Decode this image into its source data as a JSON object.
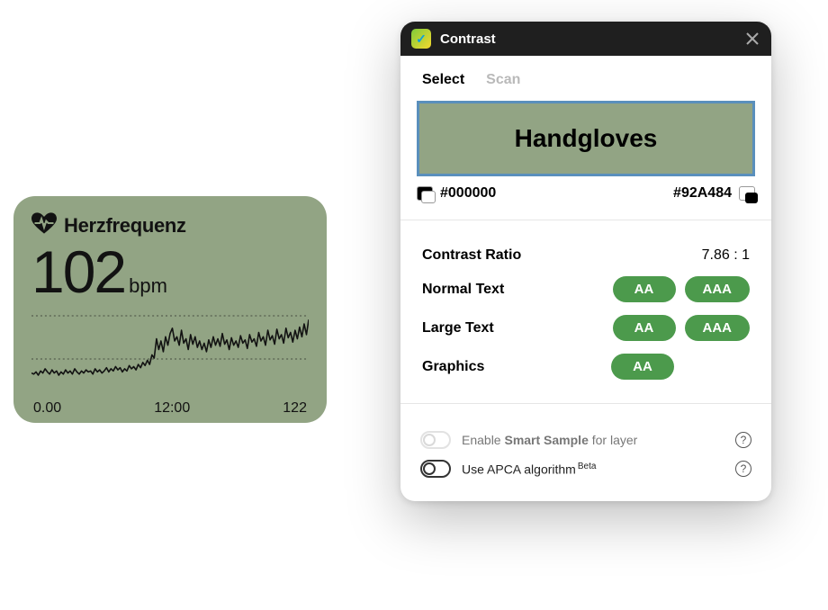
{
  "hr_card": {
    "title": "Herzfrequenz",
    "value": "102",
    "unit": "bpm",
    "axis": {
      "start": "0.00",
      "mid": "12:00",
      "end": "122"
    }
  },
  "contrast_panel": {
    "title": "Contrast",
    "tabs": {
      "select": "Select",
      "scan": "Scan"
    },
    "sample_text": "Handgloves",
    "fg_color": "#000000",
    "bg_color": "#92A484",
    "ratio_label": "Contrast Ratio",
    "ratio_value": "7.86 : 1",
    "rows": {
      "normal": {
        "label": "Normal Text",
        "aa": "AA",
        "aaa": "AAA"
      },
      "large": {
        "label": "Large Text",
        "aa": "AA",
        "aaa": "AAA"
      },
      "graphics": {
        "label": "Graphics",
        "aa": "AA"
      }
    },
    "options": {
      "smart_sample_pre": "Enable ",
      "smart_sample_strong": "Smart Sample",
      "smart_sample_post": " for layer",
      "apca_pre": "Use APCA algorithm",
      "apca_badge": "Beta",
      "help": "?"
    }
  },
  "chart_data": {
    "type": "line",
    "title": "Herzfrequenz",
    "xlabel": "",
    "ylabel": "bpm",
    "ylim": [
      60,
      140
    ],
    "x_tick_labels": [
      "0.00",
      "12:00",
      "122"
    ],
    "x": [
      0,
      1,
      2,
      3,
      4,
      5,
      6,
      7,
      8,
      9,
      10,
      11,
      12,
      13,
      14,
      15,
      16,
      17,
      18,
      19,
      20,
      21,
      22,
      23,
      24,
      25,
      26,
      27,
      28,
      29,
      30,
      31,
      32,
      33,
      34,
      35,
      36,
      37,
      38,
      39,
      40,
      41,
      42,
      43,
      44,
      45,
      46,
      47,
      48,
      49,
      50,
      51,
      52,
      53,
      54,
      55,
      56,
      57,
      58,
      59,
      60,
      61,
      62,
      63,
      64,
      65,
      66,
      67,
      68,
      69,
      70,
      71,
      72,
      73,
      74,
      75,
      76,
      77,
      78,
      79,
      80,
      81,
      82,
      83,
      84,
      85,
      86,
      87,
      88,
      89,
      90,
      91,
      92,
      93,
      94,
      95,
      96,
      97,
      98,
      99,
      100,
      101,
      102,
      103,
      104,
      105,
      106,
      107,
      108,
      109,
      110,
      111,
      112,
      113,
      114,
      115,
      116,
      117,
      118,
      119,
      120,
      121,
      122
    ],
    "values": [
      78,
      77,
      79,
      76,
      80,
      78,
      82,
      79,
      77,
      81,
      78,
      80,
      76,
      79,
      77,
      81,
      78,
      80,
      77,
      82,
      79,
      77,
      80,
      78,
      81,
      79,
      80,
      77,
      82,
      79,
      81,
      78,
      80,
      83,
      79,
      82,
      80,
      84,
      81,
      83,
      79,
      82,
      80,
      85,
      82,
      84,
      81,
      86,
      83,
      88,
      85,
      90,
      86,
      95,
      92,
      110,
      100,
      108,
      98,
      112,
      104,
      115,
      120,
      108,
      112,
      104,
      118,
      106,
      110,
      100,
      114,
      105,
      112,
      102,
      108,
      100,
      106,
      98,
      109,
      102,
      112,
      104,
      110,
      103,
      115,
      105,
      109,
      100,
      111,
      104,
      108,
      102,
      113,
      106,
      109,
      101,
      114,
      107,
      110,
      103,
      116,
      108,
      112,
      104,
      118,
      109,
      113,
      105,
      119,
      110,
      114,
      106,
      120,
      111,
      116,
      107,
      118,
      110,
      121,
      112,
      124,
      114,
      128
    ],
    "note": "y values are estimated (bpm) from an unlabeled sparkline; gridlines near y≈90 and y≈130"
  }
}
